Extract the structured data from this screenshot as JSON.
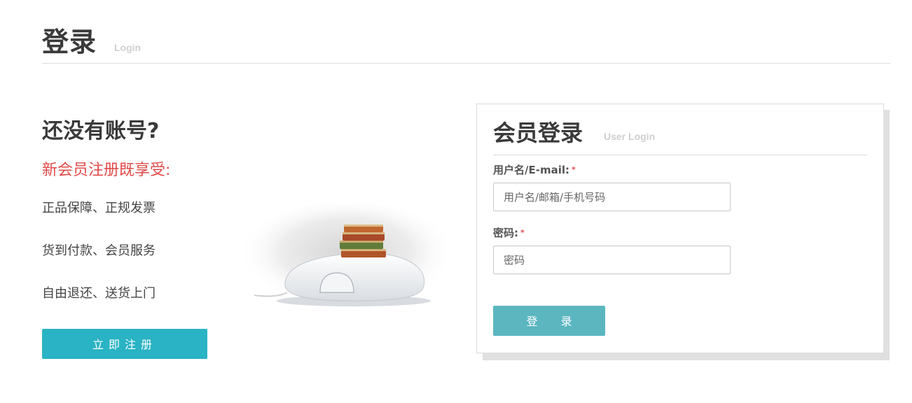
{
  "header": {
    "title": "登录",
    "subtitle": "Login"
  },
  "promo": {
    "heading": "还没有账号?",
    "subheading": "新会员注册既享受:",
    "benefits": [
      "正品保障、正规发票",
      "货到付款、会员服务",
      "自由退还、送货上门"
    ],
    "register_label": "立即注册"
  },
  "login": {
    "title": "会员登录",
    "subtitle": "User Login",
    "username_label": "用户名/E-mail:",
    "username_placeholder": "用户名/邮箱/手机号码",
    "password_label": "密码:",
    "password_placeholder": "密码",
    "required_mark": "*",
    "submit_label": "登 录"
  },
  "colors": {
    "accent": "#29b3c4",
    "login_button": "#5bb6c0",
    "highlight": "#e14a4a"
  }
}
